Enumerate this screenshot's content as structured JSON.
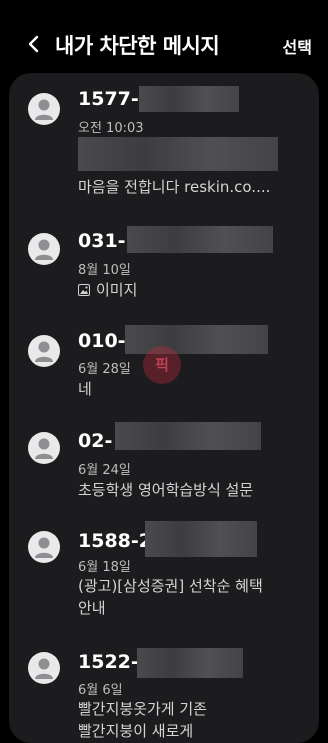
{
  "header": {
    "title": "내가 차단한 메시지",
    "select_label": "선택"
  },
  "messages": [
    {
      "name": "1577-",
      "date": "오전 10:03",
      "lines": [
        "",
        "마음을 전합니다 reskin.co...."
      ]
    },
    {
      "name": "031-",
      "date": "8월 10일",
      "lines": [
        "이미지"
      ]
    },
    {
      "name": "010-",
      "date": "6월 28일",
      "lines": [
        "네"
      ]
    },
    {
      "name": "02-",
      "date": "6월 24일",
      "lines": [
        "초등학생 영어학습방식 설문"
      ]
    },
    {
      "name": "1588-2",
      "date": "6월 18일",
      "lines": [
        "(광고)[삼성증권] 선착순 혜택",
        "안내"
      ]
    },
    {
      "name": "1522-",
      "date": "6월 6일",
      "lines": [
        "빨간지붕옷가게 기존",
        "빨간지붕이 새로게"
      ]
    }
  ],
  "icons": {
    "back": "back-arrow-icon",
    "avatar": "person-icon",
    "image": "image-icon"
  },
  "colors": {
    "background": "#000000",
    "panel": "#1c1c1e",
    "avatar_bg": "#e9e9ea",
    "avatar_fg": "#8e8e93"
  }
}
